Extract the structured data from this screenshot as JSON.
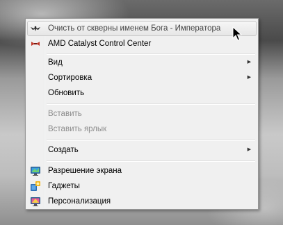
{
  "menu": {
    "items": [
      {
        "label": "Очисть от скверны именем Бога - Императора",
        "icon": "aquila-icon",
        "state": "hover"
      },
      {
        "label": "AMD Catalyst Control Center",
        "icon": "amd-catalyst-icon"
      },
      {
        "label": "Вид",
        "submenu": true
      },
      {
        "label": "Сортировка",
        "submenu": true
      },
      {
        "label": "Обновить"
      },
      {
        "label": "Вставить",
        "disabled": true
      },
      {
        "label": "Вставить ярлык",
        "disabled": true
      },
      {
        "label": "Создать",
        "submenu": true
      },
      {
        "label": "Разрешение экрана",
        "icon": "monitor-icon"
      },
      {
        "label": "Гаджеты",
        "icon": "gadgets-icon"
      },
      {
        "label": "Персонализация",
        "icon": "personalization-icon"
      }
    ],
    "submenu_arrow": "▶"
  },
  "colors": {
    "menu_bg": "#f0f0f0",
    "disabled_text": "#8d8d8d",
    "hover_bg": "#e6e6e6"
  }
}
